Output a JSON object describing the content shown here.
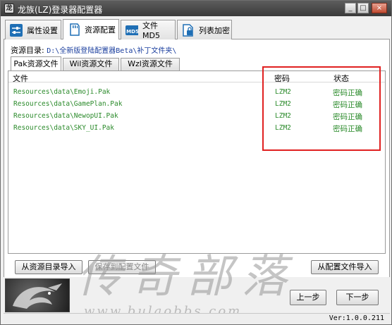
{
  "window": {
    "title": "龙族(LZ)登录器配置器",
    "icon_name": "app-logo-icon"
  },
  "top_tabs": [
    {
      "label": "属性设置",
      "icon": "settings-sliders-icon"
    },
    {
      "label": "资源配置",
      "icon": "sd-card-icon"
    },
    {
      "label": "文件MD5",
      "icon": "md5-file-icon"
    },
    {
      "label": "列表加密",
      "icon": "lock-file-icon"
    }
  ],
  "resource_dir": {
    "label": "资源目录:",
    "path": "D:\\全新版登陆配置器Beta\\补丁文件夹\\"
  },
  "sub_tabs": [
    "Pak资源文件",
    "Wil资源文件",
    "Wzl资源文件"
  ],
  "table": {
    "columns": [
      "文件",
      "密码",
      "状态"
    ],
    "rows": [
      {
        "file": "Resources\\data\\Emoji.Pak",
        "password": "LZM2",
        "status": "密码正确"
      },
      {
        "file": "Resources\\data\\GamePlan.Pak",
        "password": "LZM2",
        "status": "密码正确"
      },
      {
        "file": "Resources\\data\\NewopUI.Pak",
        "password": "LZM2",
        "status": "密码正确"
      },
      {
        "file": "Resources\\data\\SKY_UI.Pak",
        "password": "LZM2",
        "status": "密码正确"
      }
    ]
  },
  "buttons": {
    "import_from_dir": "从资源目录导入",
    "save_config": "保存到配置文件",
    "import_from_config": "从配置文件导入",
    "prev": "上一步",
    "next": "下一步"
  },
  "watermark": {
    "text": "传奇部落",
    "url": "www.bulaobbs.com"
  },
  "version": "Ver:1.0.0.211",
  "colors": {
    "ok_text": "#2a8a2a",
    "highlight": "#e02020",
    "path_text": "#1a3e9e"
  }
}
